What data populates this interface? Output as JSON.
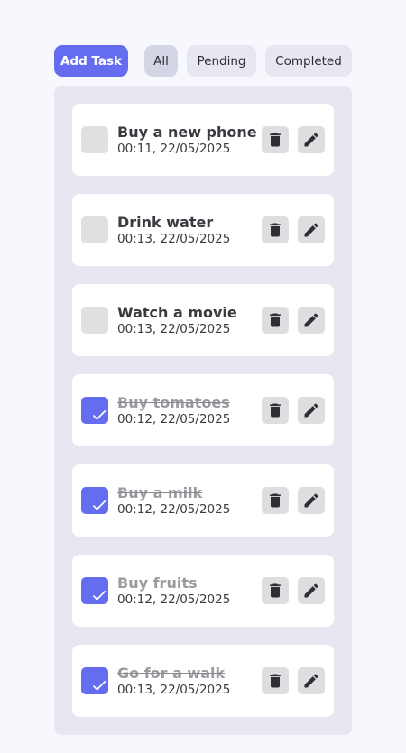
{
  "toolbar": {
    "add_label": "Add Task",
    "filters": [
      {
        "label": "All",
        "active": true
      },
      {
        "label": "Pending",
        "active": false
      },
      {
        "label": "Completed",
        "active": false
      }
    ]
  },
  "colors": {
    "accent": "#646cf0",
    "background": "#f7f8fd",
    "panel": "#e6e7f0"
  },
  "tasks": [
    {
      "title": "Buy a new phone",
      "time": "00:11, 22/05/2025",
      "completed": false
    },
    {
      "title": "Drink water",
      "time": "00:13, 22/05/2025",
      "completed": false
    },
    {
      "title": "Watch a movie",
      "time": "00:13, 22/05/2025",
      "completed": false
    },
    {
      "title": "Buy tomatoes",
      "time": "00:12, 22/05/2025",
      "completed": true
    },
    {
      "title": "Buy a milk",
      "time": "00:12, 22/05/2025",
      "completed": true
    },
    {
      "title": "Buy fruits",
      "time": "00:12, 22/05/2025",
      "completed": true
    },
    {
      "title": "Go for a walk",
      "time": "00:13, 22/05/2025",
      "completed": true
    }
  ],
  "icons": {
    "delete": "trash-icon",
    "edit": "pencil-icon",
    "check": "checkmark-icon"
  }
}
